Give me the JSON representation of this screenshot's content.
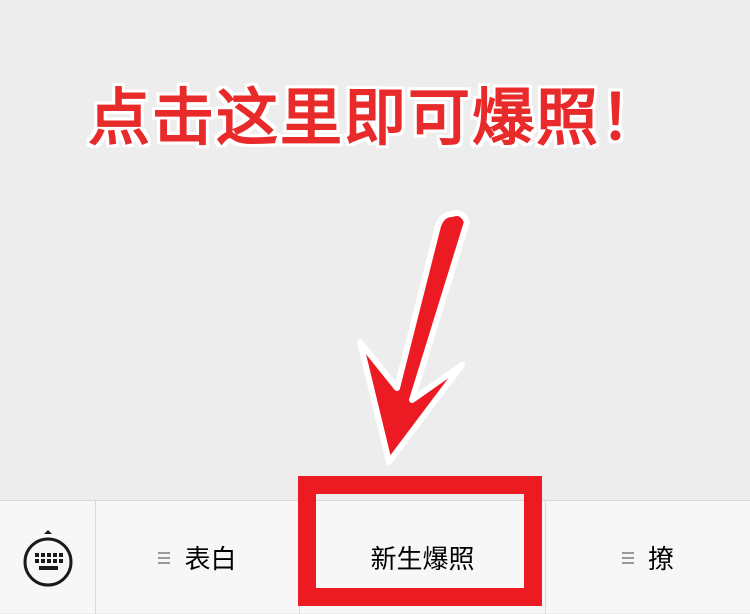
{
  "annotation": {
    "text": "点击这里即可爆照！",
    "color": "#e82a2a",
    "outline_color": "#ffffff"
  },
  "highlight": {
    "color": "#ec1b23"
  },
  "menu_bar": {
    "keyboard_icon": "keyboard-icon",
    "items": [
      {
        "label": "表白",
        "icon": "menu-lines-icon"
      },
      {
        "label": "新生爆照",
        "icon": ""
      },
      {
        "label": "撩",
        "icon": "menu-lines-icon"
      }
    ]
  }
}
